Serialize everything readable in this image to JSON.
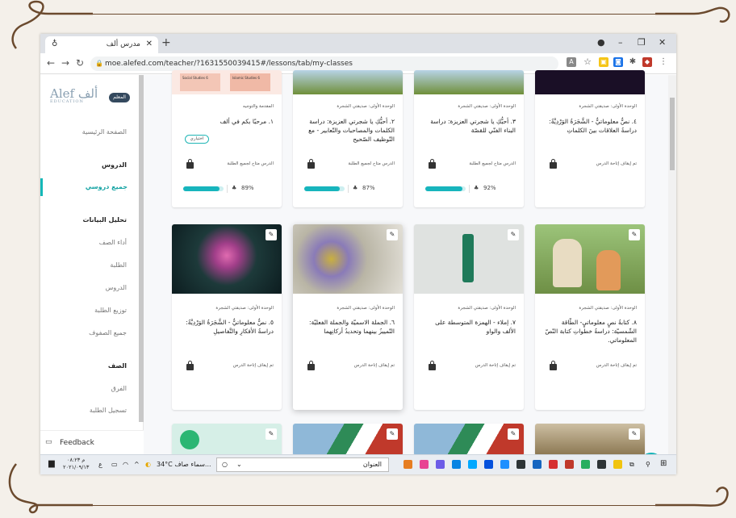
{
  "browser": {
    "tab_title": "مدرس ألف",
    "url": "moe.alefed.com/teacher/?1631550039415#/lessons/tab/my-classes"
  },
  "sidebar": {
    "logo": "Alef",
    "logo_arabic": "ألف",
    "logo_sub": "EDUCATION",
    "role_badge": "المعلم",
    "home": "الصفحة الرئيسية",
    "lessons_head": "الدروس",
    "all_lessons": "جميع دروسي",
    "analytics_head": "تحليل البيانات",
    "analytics_items": [
      "أداء الصف",
      "الطلبة",
      "الدروس",
      "توزيع الطلبة",
      "جميع الصفوف"
    ],
    "class_head": "الصف",
    "class_items": [
      "الفرق",
      "تسجيل الطلبة"
    ],
    "feedback": "Feedback"
  },
  "cards_row1": [
    {
      "unit": "المقدمة والتوجيه",
      "title": "١. مرحبًا بكم في ألف",
      "optional": "اختياري",
      "status": "الدرس متاح لجميع الطلبة",
      "progress": 89,
      "pct": "89%"
    },
    {
      "unit": "الوحدة الأولى: صديقتي الشجرة",
      "title": "٢. أحبُّكِ يا شجرتي العزيزة: دراسة الكلمات والمصاحبات والتّعابير - مع التّوظيف الصّحيح",
      "status": "الدرس متاح لجميع الطلبة",
      "progress": 87,
      "pct": "87%"
    },
    {
      "unit": "الوحدة الأولى: صديقتي الشجرة",
      "title": "٣. أحبُّكِ يا شجرتي العزيزة: دراسة البناء الفنّي للقصّة",
      "status": "الدرس متاح لجميع الطلبة",
      "progress": 92,
      "pct": "92%"
    },
    {
      "unit": "الوحدة الأولى: صديقتي الشجرة",
      "title": "٤. نصٌّ معلوماتيٌّ - الشَّجَرَةُ الوَرْدِيَّةُ: دراسةُ العلاقات بينَ الكلماتِ",
      "status": "تم إيقاف إتاحة الدرس"
    }
  ],
  "cards_row2": [
    {
      "unit": "الوحدة الأولى: صديقتي الشجرة",
      "title": "٥. نصٌّ معلوماتيٌّ - الشَّجَرَةُ الوَرْدِيَّةُ: دراسةُ الأفكارِ والتَّفاصيلِ",
      "status": "تم إيقاف إتاحة الدرس"
    },
    {
      "unit": "الوحدة الأولى: صديقتي الشجرة",
      "title": "٦. الجملة الاسميّة والجملة الفعليّة: التّمييزُ بينهما وتحديدُ أركانِهما",
      "status": "تم إيقاف إتاحة الدرس"
    },
    {
      "unit": "الوحدة الأولى: صديقتي الشجرة",
      "title": "٧. إملاء - الهمزة المتوسطة على الألف والواو",
      "status": "تم إيقاف إتاحة الدرس"
    },
    {
      "unit": "الوحدة الأولى: صديقتي الشجرة",
      "title": "٨. كتابةُ نصٍ معلوماتيٍ- الطّاقة الشّمسيّة: دراسةُ خطواتِ كتابة النّصّ المعلوماتي.",
      "status": "تم إيقاف إتاحة الدرس"
    }
  ],
  "thumb_texts": {
    "c1a": "Social Studies 6",
    "c1b": "Islamic Studies 6"
  },
  "taskbar": {
    "search_label": "العنوان",
    "weather": "34°C سماء صاف...",
    "time": "م ٠٨:٢٣",
    "date": "٢٠٢١/٠٩/١٣",
    "lang": "ع"
  },
  "colors": {
    "accent": "#17b5bd",
    "sidebar_active": "#14a3a3"
  }
}
